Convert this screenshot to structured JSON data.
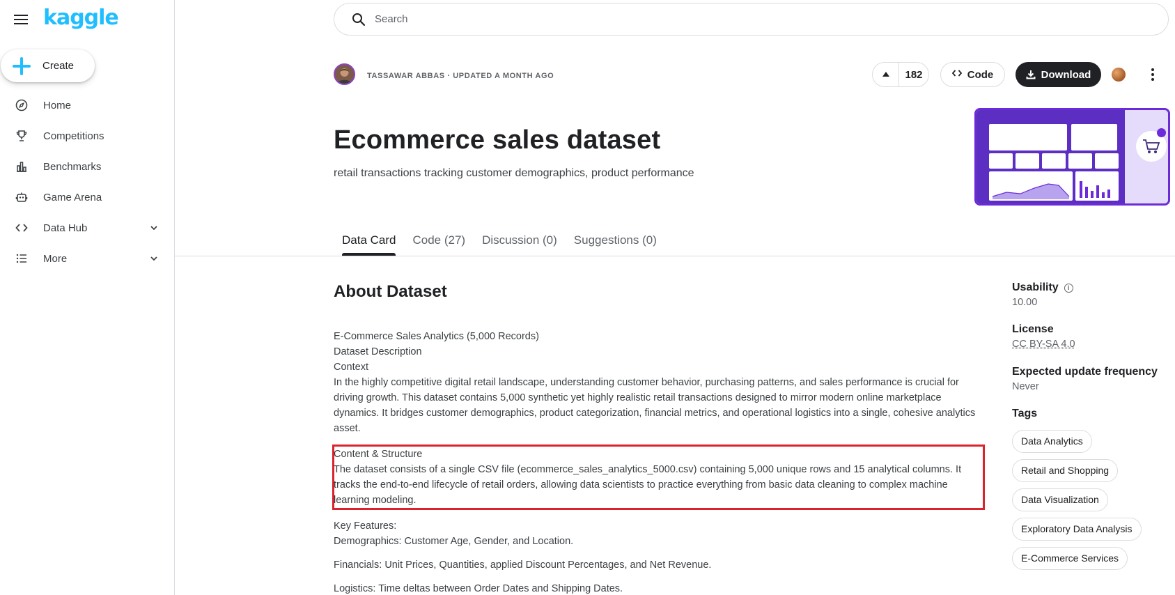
{
  "app": {
    "logo_text": "kaggle",
    "brand_color": "#20beff"
  },
  "sidebar": {
    "create_label": "Create",
    "items": [
      {
        "label": "Home",
        "icon": "compass-icon"
      },
      {
        "label": "Competitions",
        "icon": "trophy-icon"
      },
      {
        "label": "Benchmarks",
        "icon": "bar-chart-icon"
      },
      {
        "label": "Game Arena",
        "icon": "robot-icon"
      },
      {
        "label": "Data Hub",
        "icon": "code-brackets-icon",
        "expandable": true
      },
      {
        "label": "More",
        "icon": "list-icon",
        "expandable": true
      }
    ]
  },
  "search": {
    "placeholder": "Search",
    "value": ""
  },
  "header": {
    "author_line": "TASSAWAR ABBAS · UPDATED A MONTH AGO",
    "vote_count": "182",
    "code_label": "Code",
    "download_label": "Download"
  },
  "dataset": {
    "title": "Ecommerce sales dataset",
    "subtitle": "retail transactions tracking customer demographics, product performance"
  },
  "tabs": [
    {
      "label": "Data Card",
      "active": true
    },
    {
      "label": "Code (27)",
      "active": false
    },
    {
      "label": "Discussion (0)",
      "active": false
    },
    {
      "label": "Suggestions (0)",
      "active": false
    }
  ],
  "about": {
    "heading": "About Dataset",
    "intro_lines": [
      "E-Commerce Sales Analytics (5,000 Records)",
      "Dataset Description",
      "Context"
    ],
    "context_paragraph": "In the highly competitive digital retail landscape, understanding customer behavior, purchasing patterns, and sales performance is crucial for driving growth. This dataset contains 5,000 synthetic yet highly realistic retail transactions designed to mirror modern online marketplace dynamics. It bridges customer demographics, product categorization, financial metrics, and operational logistics into a single, cohesive analytics asset.",
    "structure_heading": "Content & Structure",
    "structure_paragraph": "The dataset consists of a single CSV file (ecommerce_sales_analytics_5000.csv) containing 5,000 unique rows and 15 analytical columns. It tracks the end-to-end lifecycle of retail orders, allowing data scientists to practice everything from basic data cleaning to complex machine learning modeling.",
    "features_heading": "Key Features:",
    "feature_demographics": "Demographics: Customer Age, Gender, and Location.",
    "feature_financials": "Financials: Unit Prices, Quantities, applied Discount Percentages, and Net Revenue.",
    "feature_logistics": "Logistics: Time deltas between Order Dates and Shipping Dates."
  },
  "meta": {
    "usability_label": "Usability",
    "usability_value": "10.00",
    "license_label": "License",
    "license_value": "CC BY-SA 4.0",
    "frequency_label": "Expected update frequency",
    "frequency_value": "Never",
    "tags_label": "Tags",
    "tags": [
      "Data Analytics",
      "Retail and Shopping",
      "Data Visualization",
      "Exploratory Data Analysis",
      "E-Commerce Services"
    ]
  },
  "colors": {
    "highlight_border": "#d9232d",
    "download_bg": "#202124",
    "thumbnail_accent": "#6c2bd9"
  }
}
